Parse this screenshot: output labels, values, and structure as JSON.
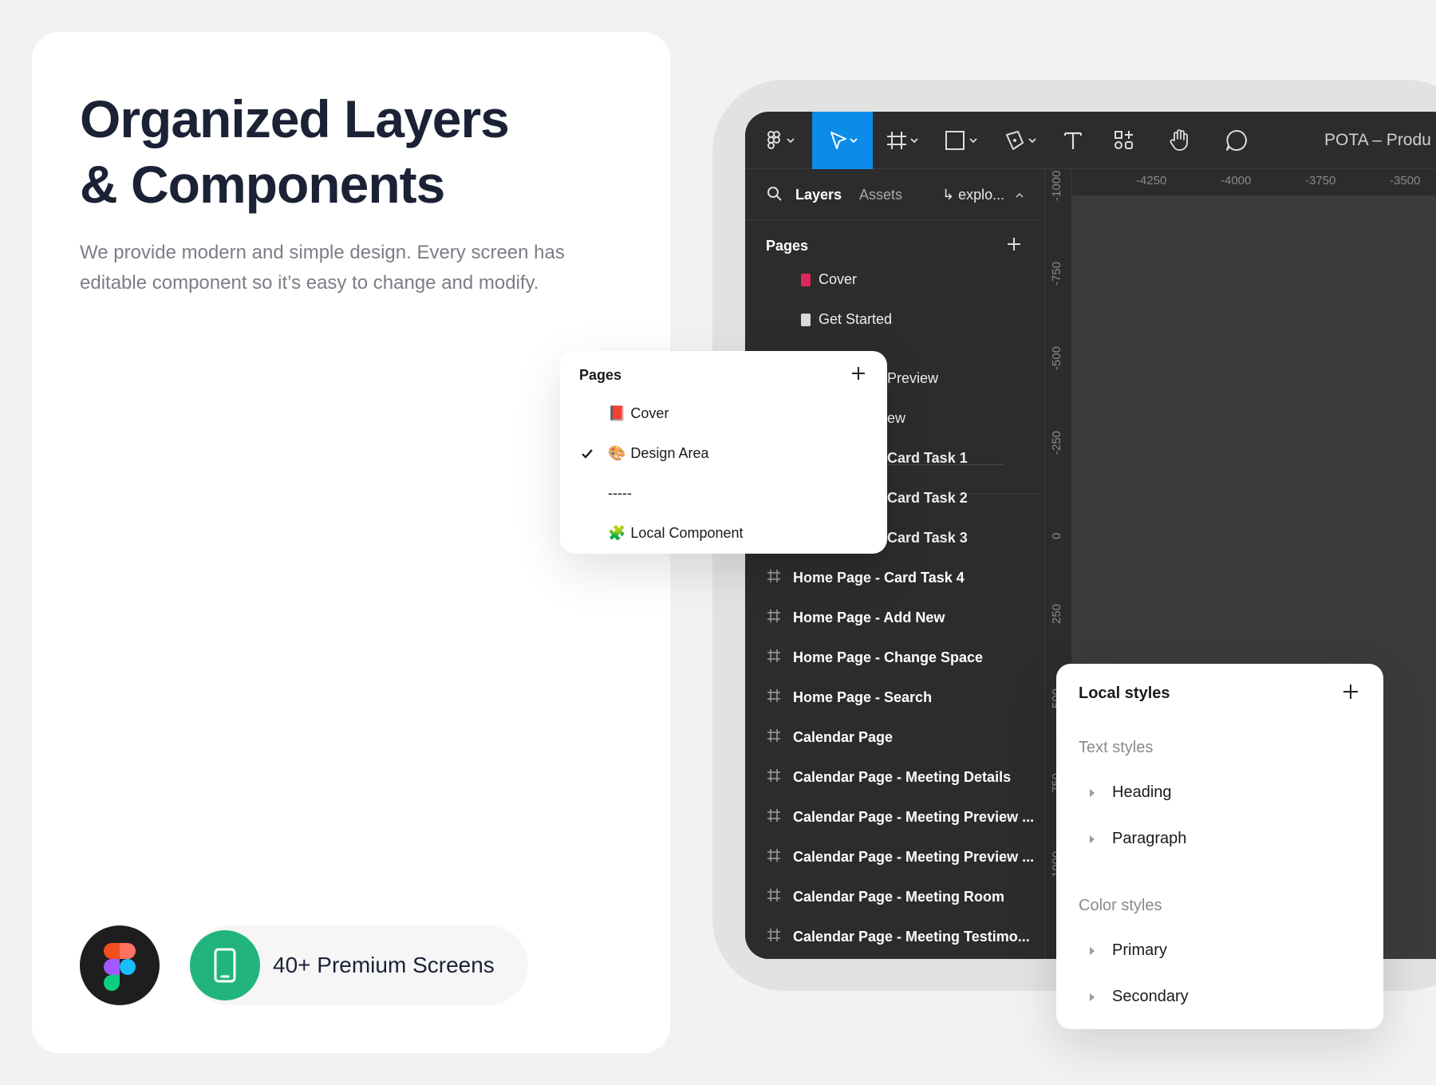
{
  "hero": {
    "title_line1": "Organized Layers",
    "title_line2": "& Components",
    "subtitle_line1": "We provide modern and simple design. Every screen has",
    "subtitle_line2": "editable component so it’s easy to change and modify."
  },
  "badge": {
    "screens_label": "40+ Premium Screens"
  },
  "toolbar": {
    "doc_title": "POTA – Produ",
    "tools": [
      "main-menu",
      "move",
      "frame",
      "shape",
      "pen",
      "text",
      "resources",
      "hand",
      "comment"
    ]
  },
  "sidebar": {
    "tab_layers": "Layers",
    "tab_assets": "Assets",
    "tab_page": "↳ explo...",
    "pages_header": "Pages",
    "pages": [
      {
        "label": "Cover",
        "swatch": "#e0245e"
      },
      {
        "label": "Get Started",
        "swatch": "#d9d9d9"
      }
    ],
    "partial_items": [
      "Preview",
      "ew"
    ],
    "partial_layers": [
      "Card Task 1",
      "Card Task 2",
      "Card Task 3"
    ],
    "layers": [
      "Home Page - Card Task 4",
      "Home Page - Add New",
      "Home Page - Change Space",
      "Home Page - Search",
      "Calendar Page",
      "Calendar Page - Meeting Details",
      "Calendar Page - Meeting Preview ...",
      "Calendar Page - Meeting Preview ...",
      "Calendar Page - Meeting Room",
      "Calendar Page - Meeting Testimo..."
    ]
  },
  "rulers": {
    "horizontal": [
      "-4250",
      "-4000",
      "-3750",
      "-3500"
    ],
    "vertical": [
      "-1000",
      "-750",
      "-500",
      "-250",
      "0",
      "250",
      "500",
      "750",
      "1000"
    ]
  },
  "pages_popup": {
    "title": "Pages",
    "items": [
      {
        "icon": "📕",
        "label": "Cover"
      },
      {
        "icon": "🎨",
        "label": "Design Area"
      },
      {
        "icon": "",
        "label": "-----"
      },
      {
        "icon": "🧩",
        "label": "Local Component"
      }
    ]
  },
  "local_styles": {
    "title": "Local styles",
    "text_styles_header": "Text styles",
    "text_styles": [
      "Heading",
      "Paragraph"
    ],
    "color_styles_header": "Color styles",
    "color_styles": [
      "Primary",
      "Secondary"
    ]
  },
  "colors": {
    "accent_blue": "#0c8ce9",
    "brand_green": "#21b57d",
    "heading_navy": "#1b2236"
  }
}
